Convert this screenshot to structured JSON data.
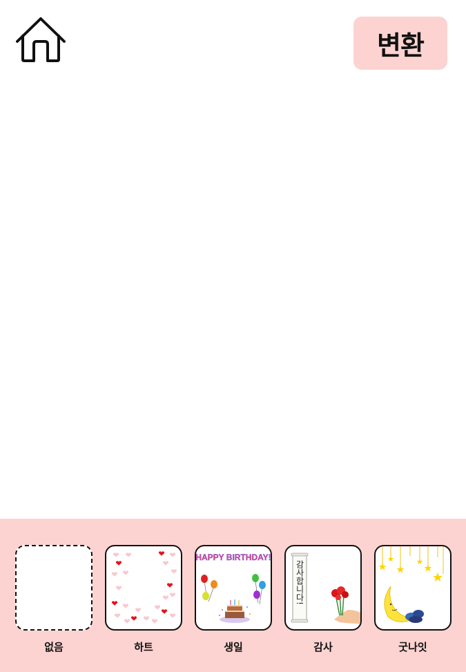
{
  "header": {
    "home_icon": "home-icon",
    "convert_label": "변환"
  },
  "preview": {},
  "frames": [
    {
      "id": "none",
      "label": "없음",
      "icon": "empty-frame"
    },
    {
      "id": "heart",
      "label": "하트",
      "icon": "hearts-frame"
    },
    {
      "id": "birthday",
      "label": "생일",
      "icon": "birthday-frame",
      "banner_text": "HAPPY BIRTHDAY!"
    },
    {
      "id": "thanks",
      "label": "감사",
      "icon": "thanks-frame",
      "scroll_text": "감사합니다!"
    },
    {
      "id": "goodnight",
      "label": "굿나잇",
      "icon": "moon-stars-frame"
    }
  ],
  "colors": {
    "panel_bg": "#fcd3d0",
    "button_bg": "#fcd3d0",
    "heart_red": "#e8101c",
    "heart_pink": "#f7c9cf"
  }
}
